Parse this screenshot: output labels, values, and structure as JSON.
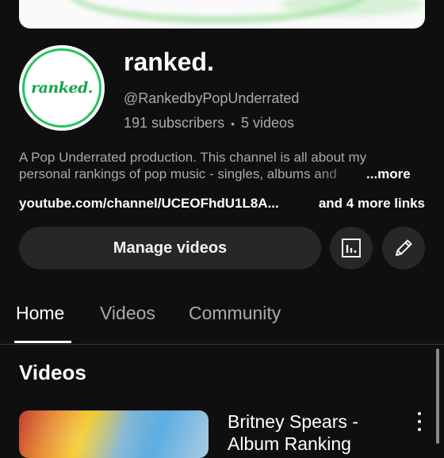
{
  "channel": {
    "name": "ranked.",
    "avatar_text": "ranked.",
    "handle": "@RankedbyPopUnderrated",
    "subscribers": "191 subscribers",
    "separator": "•",
    "videos_count": "5 videos",
    "description_line1": "A Pop Underrated production. This channel is all about my",
    "description_line2": "personal rankings of pop music - singles, albums and",
    "more_label": "...more",
    "link": "youtube.com/channel/UCEOFhdU1L8A...",
    "more_links": "and 4 more links"
  },
  "actions": {
    "manage_label": "Manage videos",
    "stats_icon": "analytics-icon",
    "edit_icon": "pencil-icon"
  },
  "tabs": [
    {
      "label": "Home",
      "active": true
    },
    {
      "label": "Videos",
      "active": false
    },
    {
      "label": "Community",
      "active": false
    }
  ],
  "section": {
    "title": "Videos"
  },
  "videos": [
    {
      "title": "Britney Spears - Album Ranking"
    }
  ],
  "colors": {
    "background": "#0f0f0f",
    "button": "#272727",
    "accent_green": "#22c55e"
  }
}
